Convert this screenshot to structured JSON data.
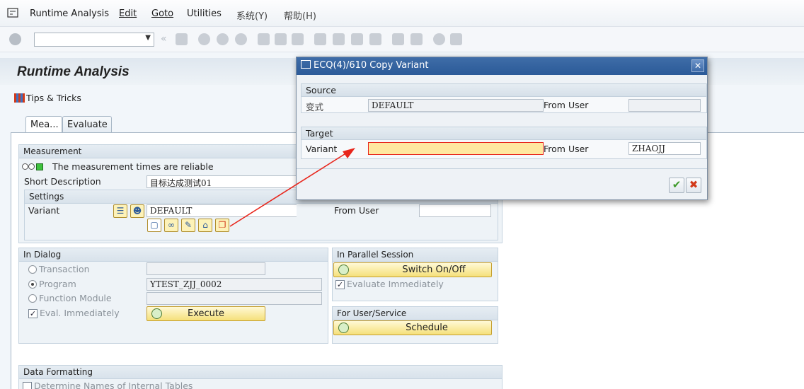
{
  "menubar": {
    "items": [
      "Runtime Analysis",
      "Edit",
      "Goto",
      "Utilities",
      "系统(Y)",
      "帮助(H)"
    ]
  },
  "toolbar": {
    "command_value": ""
  },
  "page": {
    "title": "Runtime Analysis",
    "tips_label": "Tips & Tricks"
  },
  "tabs": [
    "Mea...",
    "Evaluate"
  ],
  "measurement": {
    "header": "Measurement",
    "reliable_text": "The measurement times are reliable",
    "short_desc_label": "Short Description",
    "short_desc_value": "目标达成测试01",
    "settings_header": "Settings",
    "variant_label": "Variant",
    "variant_value": "DEFAULT",
    "from_user_label": "From User",
    "from_user_value": ""
  },
  "dialog_section": {
    "header": "In Dialog",
    "transaction_label": "Transaction",
    "program_label": "Program",
    "program_value": "YTEST_ZJJ_0002",
    "function_module_label": "Function Module",
    "eval_immediately_label": "Eval. Immediately",
    "execute_label": "Execute"
  },
  "parallel": {
    "header": "In Parallel Session",
    "switch_label": "Switch On/Off",
    "evaluate_immediately_label": "Evaluate Immediately"
  },
  "user_service": {
    "header": "For User/Service",
    "schedule_label": "Schedule"
  },
  "data_formatting": {
    "header": "Data Formatting",
    "determine_names_label": "Determine Names of Internal Tables"
  },
  "copy_dialog": {
    "title": "ECQ(4)/610 Copy Variant",
    "source_header": "Source",
    "source_variant_label": "变式",
    "source_variant_value": "DEFAULT",
    "source_from_user_label": "From User",
    "source_from_user_value": "",
    "target_header": "Target",
    "target_variant_label": "Variant",
    "target_variant_value": "",
    "target_from_user_label": "From User",
    "target_from_user_value": "ZHAOJJ",
    "close_glyph": "✕",
    "ok_glyph": "✔",
    "cancel_glyph": "✖"
  },
  "icons": {
    "accent_arrow_color": "#e8251b",
    "dialog_title_color": "#2b5a98",
    "button_yellow": "#f5e07a"
  }
}
